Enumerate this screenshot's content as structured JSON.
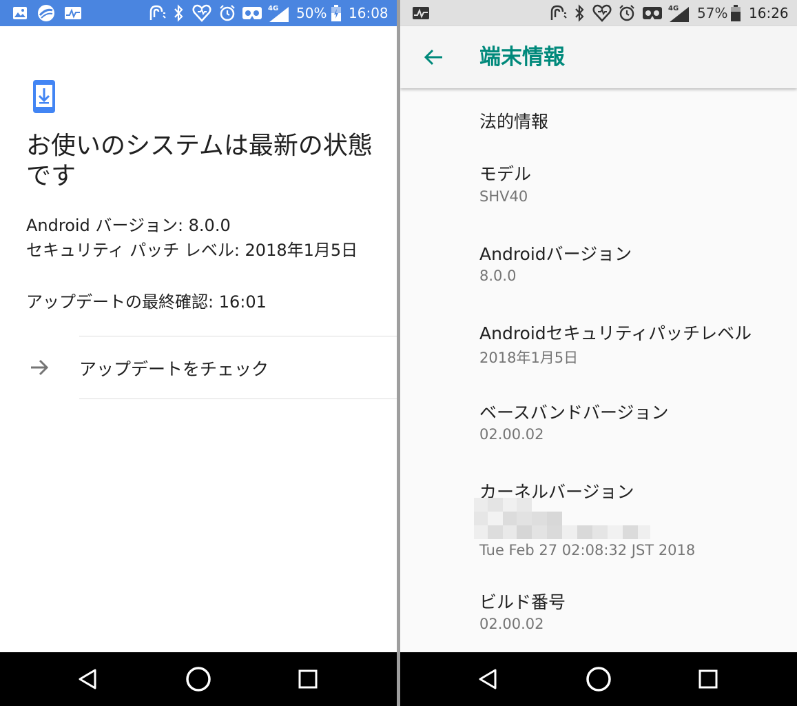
{
  "left": {
    "status": {
      "battery": "50%",
      "time": "16:08",
      "network": "4G"
    },
    "heading": "お使いのシステムは最新の状態です",
    "android_version": "Android バージョン: 8.0.0",
    "security_patch": "セキュリティ パッチ レベル: 2018年1月5日",
    "last_check": "アップデートの最終確認: 16:01",
    "check_button": "アップデートをチェック"
  },
  "right": {
    "status": {
      "battery": "57%",
      "time": "16:26",
      "network": "4G"
    },
    "title": "端末情報",
    "items": [
      {
        "title": "法的情報"
      },
      {
        "title": "モデル",
        "value": "SHV40"
      },
      {
        "title": "Androidバージョン",
        "value": "8.0.0"
      },
      {
        "title": "Androidセキュリティパッチレベル",
        "value": "2018年1月5日"
      },
      {
        "title": "ベースバンドバージョン",
        "value": "02.00.02"
      },
      {
        "title": "カーネルバージョン",
        "value": "Tue Feb 27 02:08:32 JST 2018"
      },
      {
        "title": "ビルド番号",
        "value": "02.00.02"
      }
    ]
  },
  "colors": {
    "accent": "#00897b",
    "statusbar_left": "#4a85e0",
    "system_update_icon": "#4285f4"
  },
  "icons": [
    "gallery-icon",
    "trend-micro-icon",
    "activity-icon",
    "nfc-icon",
    "bluetooth-icon",
    "heart-icon",
    "alarm-icon",
    "vr-icon",
    "signal-icon",
    "battery-icon",
    "system-update-icon",
    "arrow-right-icon",
    "back-arrow-icon",
    "nav-back-icon",
    "nav-home-icon",
    "nav-recents-icon"
  ]
}
